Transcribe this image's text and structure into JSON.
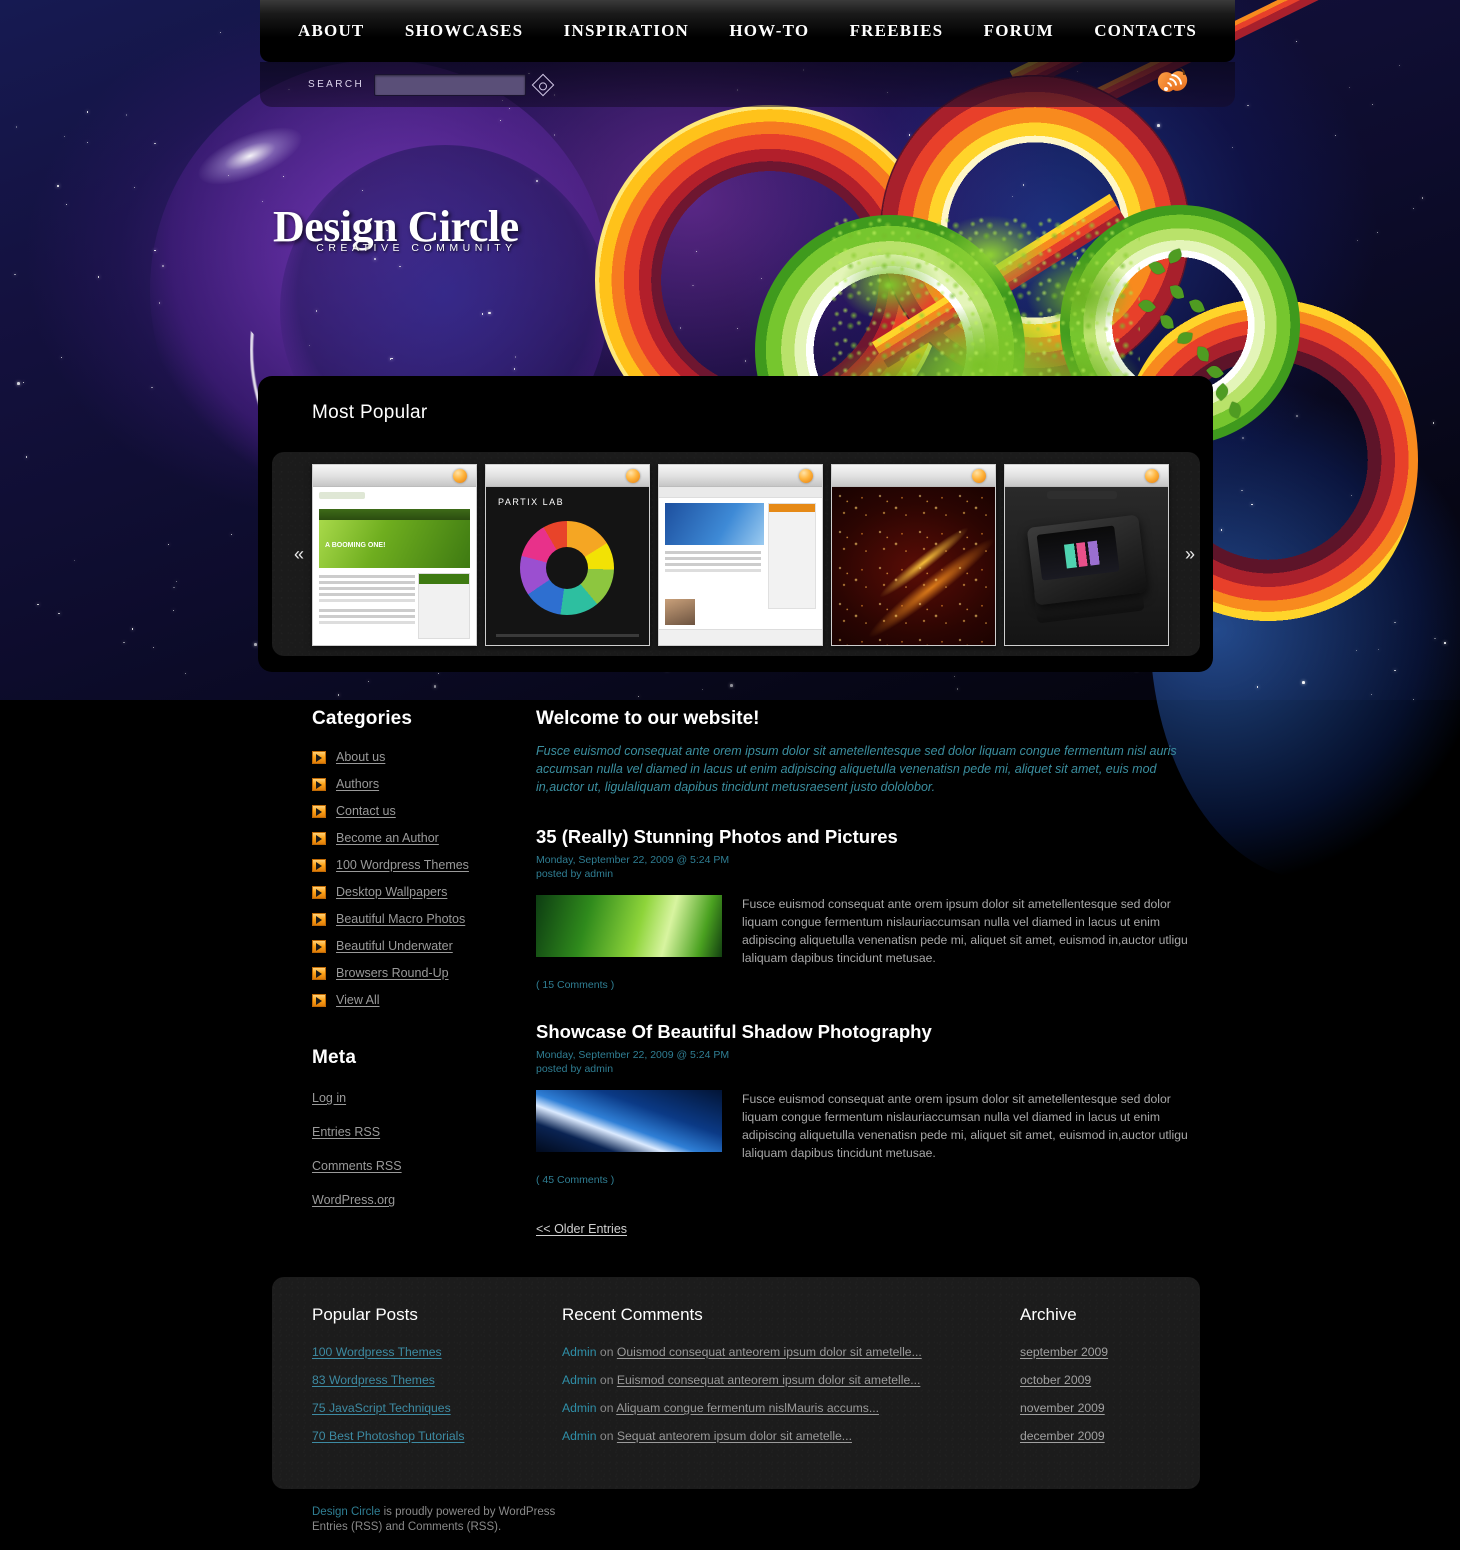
{
  "nav": {
    "items": [
      {
        "label": "ABOUT"
      },
      {
        "label": "SHOWCASES"
      },
      {
        "label": "INSPIRATION"
      },
      {
        "label": "HOW-TO"
      },
      {
        "label": "FREEBIES"
      },
      {
        "label": "FORUM"
      },
      {
        "label": "CONTACTS"
      }
    ]
  },
  "search": {
    "label": "SEARCH",
    "value": "",
    "placeholder": "",
    "go_icon": "search-icon",
    "rss_icon": "rss-heart-icon"
  },
  "logo": {
    "title": "Design Circle",
    "tagline": "CREATIVE COMMUNITY"
  },
  "popular": {
    "title": "Most Popular",
    "prev_arrow": "«",
    "next_arrow": "»",
    "thumbs": [
      {
        "name": "balancer-green-website-screenshot",
        "caption": "A BOOMING ONE!"
      },
      {
        "name": "partix-lab-pie-chart-screenshot",
        "caption": "PARTIX LAB"
      },
      {
        "name": "blue-corporate-website-screenshot",
        "caption": ""
      },
      {
        "name": "fire-sparks-abstract-artwork",
        "caption": ""
      },
      {
        "name": "black-slider-phone-device-screenshot",
        "caption": ""
      }
    ]
  },
  "sidebar": {
    "categories_title": "Categories",
    "categories": [
      {
        "label": "About us"
      },
      {
        "label": "Authors"
      },
      {
        "label": "Contact us"
      },
      {
        "label": "Become an Author"
      },
      {
        "label": "100 Wordpress Themes"
      },
      {
        "label": "Desktop Wallpapers"
      },
      {
        "label": "Beautiful Macro Photos"
      },
      {
        "label": "Beautiful Underwater"
      },
      {
        "label": "Browsers Round-Up"
      },
      {
        "label": "View All"
      }
    ],
    "meta_title": "Meta",
    "meta": [
      {
        "label": "Log in"
      },
      {
        "label": "Entries RSS"
      },
      {
        "label": "Comments RSS"
      },
      {
        "label": "WordPress.org"
      }
    ]
  },
  "main": {
    "welcome_title": "Welcome to our website!",
    "welcome_text": "Fusce euismod consequat ante orem ipsum dolor sit ametellentesque sed dolor liquam congue fermentum nisl auris accumsan nulla vel diamed in lacus ut enim adipiscing aliquetulla venenatisn pede mi, aliquet sit amet, euis mod in,auctor ut, ligulaliquam dapibus tincidunt metusraesent justo dololobor.",
    "posts": [
      {
        "title": "35 (Really) Stunning Photos and Pictures",
        "date": "Monday, September 22, 2009 @ 5:24 PM",
        "author": "posted by admin",
        "excerpt": "Fusce euismod consequat ante orem ipsum dolor sit ametellentesque sed dolor liquam congue fermentum nislauriaccumsan nulla vel diamed in lacus ut enim adipiscing aliquetulla venenatisn pede mi, aliquet sit amet, euismod in,auctor utligu laliquam dapibus tincidunt metusae.",
        "comments": "( 15 Comments )",
        "thumb": "green-leaf-abstract-thumbnail"
      },
      {
        "title": "Showcase Of Beautiful Shadow Photography",
        "date": "Monday, September 22, 2009 @ 5:24 PM",
        "author": "posted by admin",
        "excerpt": "Fusce euismod consequat ante orem ipsum dolor sit ametellentesque sed dolor liquam congue fermentum nislauriaccumsan nulla vel diamed in lacus ut enim adipiscing aliquetulla venenatisn pede mi, aliquet sit amet, euismod in,auctor utligu laliquam dapibus tincidunt metusae.",
        "comments": "( 45 Comments )",
        "thumb": "blue-space-horizon-thumbnail"
      }
    ],
    "older_entries": "<< Older Entries"
  },
  "footer": {
    "popular_posts_title": "Popular Posts",
    "popular_posts": [
      {
        "label": "100 Wordpress Themes"
      },
      {
        "label": "83 Wordpress Themes"
      },
      {
        "label": "75 JavaScript Techniques"
      },
      {
        "label": "70 Best Photoshop Tutorials"
      }
    ],
    "recent_comments_title": "Recent Comments",
    "recent_comments": [
      {
        "author": "Admin",
        "on": "on",
        "text": "Ouismod consequat anteorem ipsum dolor sit ametelle..."
      },
      {
        "author": "Admin",
        "on": "on",
        "text": "Euismod consequat anteorem ipsum dolor sit ametelle..."
      },
      {
        "author": "Admin",
        "on": "on",
        "text": "Aliquam congue fermentum nislMauris accums..."
      },
      {
        "author": "Admin",
        "on": "on",
        "text": "Sequat anteorem ipsum dolor sit ametelle..."
      }
    ],
    "archive_title": "Archive",
    "archive": [
      {
        "label": "september 2009"
      },
      {
        "label": "october 2009"
      },
      {
        "label": "november 2009"
      },
      {
        "label": "december 2009"
      }
    ]
  },
  "copyright": {
    "brand": "Design Circle",
    "line1": " is proudly powered by WordPress",
    "line2": "Entries (RSS) and Comments (RSS)."
  },
  "colors": {
    "accent_teal": "#2f7e93",
    "accent_orange": "#ffa519",
    "link_gray": "#9a9a9a",
    "bg_black": "#000000"
  }
}
